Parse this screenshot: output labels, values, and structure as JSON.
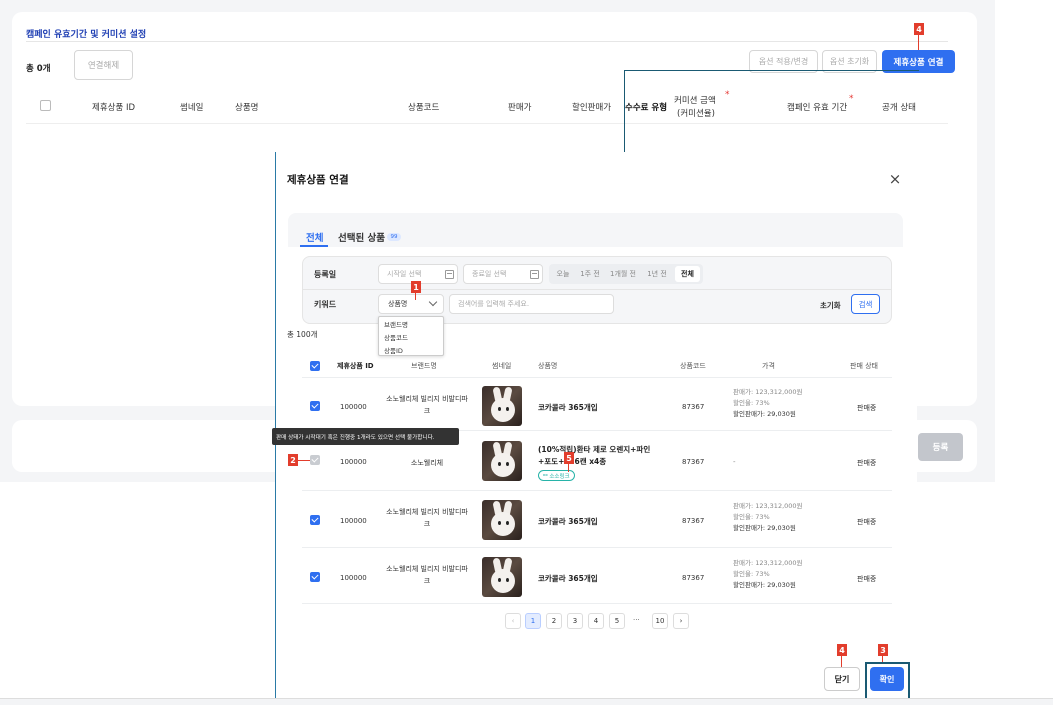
{
  "page": {
    "section_title": "캠페인 유효기간 및 커미션 설정",
    "total_label": "총 0개",
    "unlink_btn": "연결해제",
    "apply_opt_btn": "옵션 적용/변경",
    "reset_opt_btn": "옵션 초기화",
    "link_product_btn": "제휴상품 연결",
    "register_btn": "등록",
    "table_headers": [
      "제휴상품 ID",
      "썸네일",
      "상품명",
      "상품코드",
      "판매가",
      "할인판매가",
      "수수료 유형",
      "커미션 금액",
      "(커미션율)",
      "캠페인 유효 기간",
      "공개 상태"
    ]
  },
  "modal": {
    "title": "제휴상품 연결",
    "close_icon": "×",
    "tabs": {
      "all": "전체",
      "selected": "선택된 상품",
      "selected_count": "99"
    },
    "filter": {
      "reg_date_label": "등록일",
      "start_placeholder": "시작일 선택",
      "end_placeholder": "종료일 선택",
      "periods": [
        "오늘",
        "1주 전",
        "1개월 전",
        "1년 전",
        "전체"
      ],
      "keyword_label": "키워드",
      "select_value": "상품명",
      "keyword_placeholder": "검색어를 입력해 주세요.",
      "reset": "초기화",
      "search": "검색",
      "dropdown_options": [
        "브랜드명",
        "상품코드",
        "상품ID"
      ]
    },
    "total": "총 100개",
    "headers": [
      "제휴상품 ID",
      "브랜드명",
      "썸네일",
      "상품명",
      "상품코드",
      "가격",
      "판매 상태"
    ],
    "rows": [
      {
        "id": "100000",
        "brand": "소노웰리체 빌리지 비발디파크",
        "name": "코카콜라 365개입",
        "code": "87367",
        "price1": "판매가: 123,312,000원",
        "price2": "할인율: 73%",
        "price3": "할인판매가: 29,030원",
        "status": "판매중"
      },
      {
        "id": "100000",
        "brand": "소노웰리체",
        "name": "(10%적립)환타 제로 오렌지+파인+포도+… 6캔 x4종",
        "code": "87367",
        "price1": "-",
        "status": "판매중",
        "tag": "소소링크"
      },
      {
        "id": "100000",
        "brand": "소노웰리체 빌리지 비발디파크",
        "name": "코카콜라 365개입",
        "code": "87367",
        "price1": "판매가: 123,312,000원",
        "price2": "할인율: 73%",
        "price3": "할인판매가: 29,030원",
        "status": "판매중"
      },
      {
        "id": "100000",
        "brand": "소노웰리체 빌리지 비발디파크",
        "name": "코카콜라 365개입",
        "code": "87367",
        "price1": "판매가: 123,312,000원",
        "price2": "할인율: 73%",
        "price3": "할인판매가: 29,030원",
        "status": "판매중"
      }
    ],
    "tooltip": "판매 상태가 시작대기 혹은 진행중 1개라도 있으면 선택 불가합니다.",
    "pagination": {
      "pages": [
        "1",
        "2",
        "3",
        "4",
        "5",
        "10"
      ],
      "ellipsis": "···",
      "prev": "‹",
      "next": "›"
    },
    "close_btn": "닫기",
    "confirm_btn": "확인"
  },
  "callouts": [
    "1",
    "2",
    "3",
    "4",
    "4",
    "5"
  ],
  "colors": {
    "primary": "#2f6ff0",
    "callout": "#e23d2c",
    "guide": "#1a5a73"
  }
}
